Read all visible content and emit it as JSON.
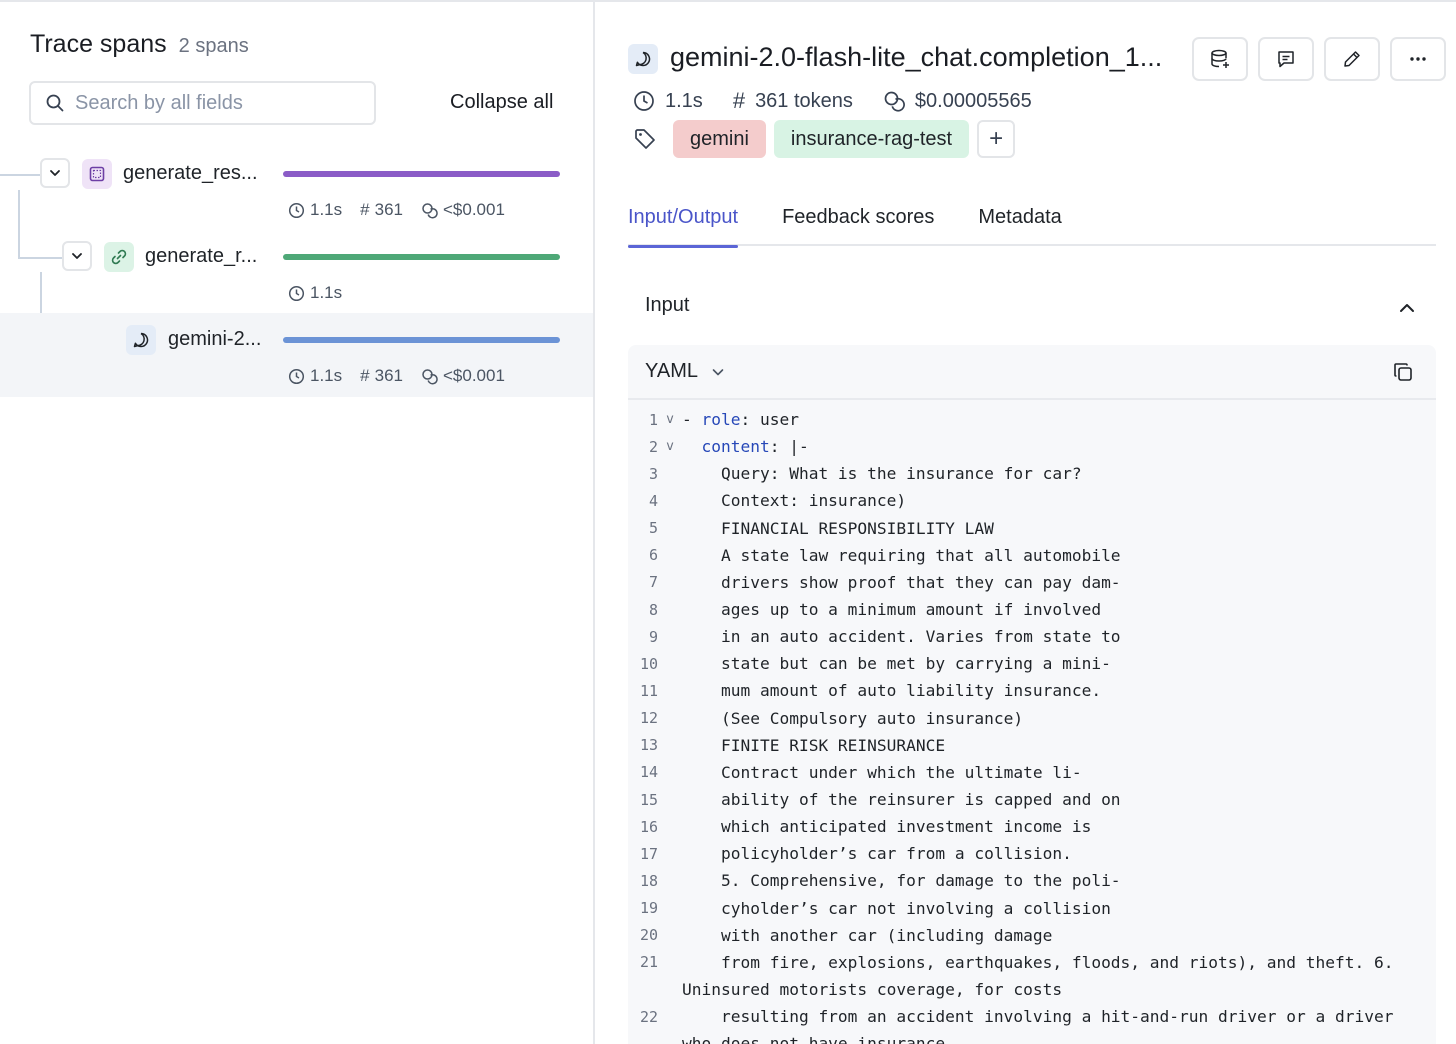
{
  "left": {
    "title": "Trace spans",
    "span_count": "2 spans",
    "search_placeholder": "Search by all fields",
    "collapse_all": "Collapse all",
    "spans": [
      {
        "name": "generate_res...",
        "color": "#8b5cc7",
        "icon": "square-icon",
        "duration": "1.1s",
        "tokens": "361",
        "cost": "<$0.001"
      },
      {
        "name": "generate_r...",
        "color": "#4ea877",
        "icon": "link-icon",
        "duration": "1.1s"
      },
      {
        "name": "gemini-2...",
        "color": "#6b93d6",
        "icon": "chat-bubble-icon",
        "duration": "1.1s",
        "tokens": "361",
        "cost": "<$0.001"
      }
    ]
  },
  "right": {
    "title": "gemini-2.0-flash-lite_chat.completion_1...",
    "duration": "1.1s",
    "tokens": "361 tokens",
    "cost": "$0.00005565",
    "tags": [
      {
        "label": "gemini",
        "bg": "#f4cccc"
      },
      {
        "label": "insurance-rag-test",
        "bg": "#d8f3e4"
      }
    ],
    "tag_add": "+",
    "tabs": [
      "Input/Output",
      "Feedback scores",
      "Metadata"
    ],
    "input_label": "Input",
    "format": "YAML",
    "code": [
      {
        "n": "1",
        "fold": true,
        "key": "- role",
        "rest": ": user",
        "indent": ""
      },
      {
        "n": "2",
        "fold": true,
        "key": "content",
        "rest": ": |-",
        "indent": "  "
      },
      {
        "n": "3",
        "text": "    Query: What is the insurance for car?"
      },
      {
        "n": "4",
        "text": "    Context: insurance)"
      },
      {
        "n": "5",
        "text": "    FINANCIAL RESPONSIBILITY LAW"
      },
      {
        "n": "6",
        "text": "    A state law requiring that all automobile"
      },
      {
        "n": "7",
        "text": "    drivers show proof that they can pay dam-"
      },
      {
        "n": "8",
        "text": "    ages up to a minimum amount if involved"
      },
      {
        "n": "9",
        "text": "    in an auto accident. Varies from state to"
      },
      {
        "n": "10",
        "text": "    state but can be met by carrying a mini-"
      },
      {
        "n": "11",
        "text": "    mum amount of auto liability insurance."
      },
      {
        "n": "12",
        "text": "    (See Compulsory auto insurance)"
      },
      {
        "n": "13",
        "text": "    FINITE RISK REINSURANCE"
      },
      {
        "n": "14",
        "text": "    Contract under which the ultimate li-"
      },
      {
        "n": "15",
        "text": "    ability of the reinsurer is capped and on"
      },
      {
        "n": "16",
        "text": "    which anticipated investment income is"
      },
      {
        "n": "17",
        "text": "    policyholder’s car from a collision."
      },
      {
        "n": "18",
        "text": "    5. Comprehensive, for damage to the poli-"
      },
      {
        "n": "19",
        "text": "    cyholder’s car not involving a collision"
      },
      {
        "n": "20",
        "text": "    with another car (including damage"
      },
      {
        "n": "21",
        "text": "    from fire, explosions, earthquakes, floods, and riots), and theft. 6."
      },
      {
        "n": "",
        "text": "Uninsured motorists coverage, for costs",
        "wrap": true
      },
      {
        "n": "22",
        "text": "    resulting from an accident involving a hit-and-run driver or a driver"
      },
      {
        "n": "",
        "text": "who does not have insurance",
        "wrap": true
      }
    ]
  }
}
